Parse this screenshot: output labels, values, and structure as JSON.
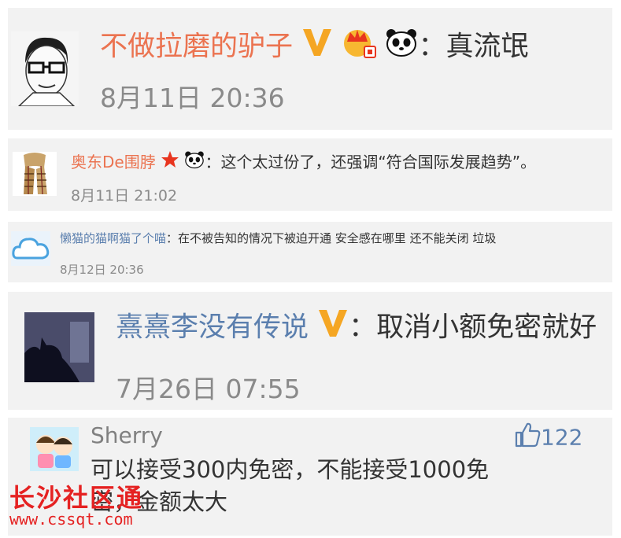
{
  "comments": [
    {
      "username": "不做拉磨的驴子",
      "text": "真流氓",
      "time": "8月11日 20:36"
    },
    {
      "username": "奥东De围脖",
      "text": "这个太过份了，还强调“符合国际发展趋势”。",
      "time": "8月11日 21:02"
    },
    {
      "username": "懒猫的猫啊猫了个喵",
      "text": "在不被告知的情况下被迫开通 安全感在哪里 还不能关闭 垃圾",
      "time": "8月12日 20:36"
    },
    {
      "username": "熹熹李没有传说",
      "text": "取消小额免密就好",
      "time": "7月26日 07:55"
    },
    {
      "username": "Sherry",
      "text_line1": "可以接受300内免密，不能接受1000免",
      "text_line2": "密，金额太大",
      "likes": "122"
    }
  ],
  "separator": "：",
  "watermark": {
    "title": "长沙社区通",
    "url": "www.cssqt.com"
  },
  "colors": {
    "username": "#eb7350",
    "username_blue": "#5b7fae",
    "verified": "#f5a623",
    "star": "#e8351f",
    "watermark": "#e52222"
  }
}
